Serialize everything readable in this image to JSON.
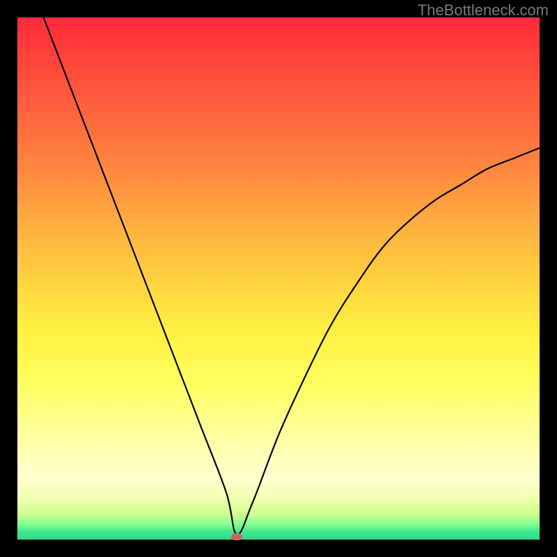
{
  "attribution": "TheBottleneck.com",
  "chart_data": {
    "type": "line",
    "title": "",
    "xlabel": "",
    "ylabel": "",
    "xlim": [
      0,
      100
    ],
    "ylim": [
      0,
      100
    ],
    "grid": false,
    "legend": false,
    "background_gradient": {
      "top_color": "#ff2a3a",
      "mid_color": "#fff040",
      "bottom_color": "#30d890",
      "meaning": "high-to-low bottleneck severity"
    },
    "series": [
      {
        "name": "bottleneck-curve",
        "type": "line",
        "color": "#000000",
        "x": [
          5,
          10,
          15,
          20,
          25,
          30,
          35,
          40,
          42,
          45,
          50,
          55,
          60,
          65,
          70,
          75,
          80,
          85,
          90,
          95,
          100
        ],
        "values": [
          100,
          87,
          74,
          61,
          48,
          35,
          22,
          9,
          1,
          7,
          20,
          31,
          41,
          49,
          56,
          61,
          65,
          68,
          71,
          73,
          75
        ]
      }
    ],
    "annotations": [
      {
        "name": "optimal-point-marker",
        "shape": "rounded-rect",
        "color": "#c66860",
        "x": 42,
        "y": 0.5
      }
    ]
  }
}
